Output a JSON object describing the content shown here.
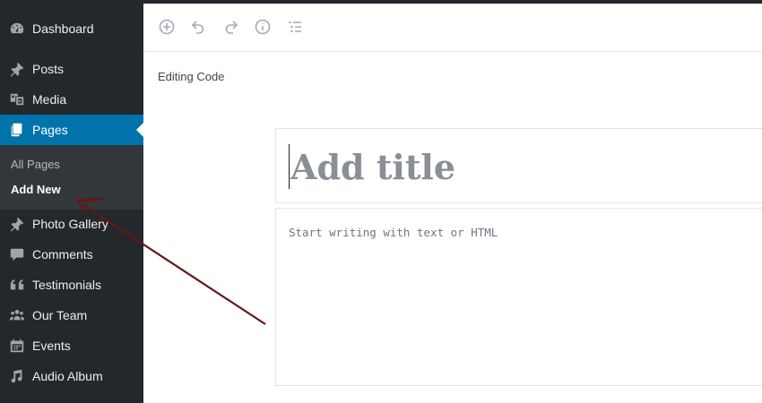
{
  "sidebar": {
    "items": [
      {
        "label": "Dashboard",
        "icon": "dashboard-icon"
      },
      {
        "label": "Posts",
        "icon": "pin-icon"
      },
      {
        "label": "Media",
        "icon": "media-icon"
      },
      {
        "label": "Pages",
        "icon": "pages-icon",
        "active": true
      },
      {
        "label": "Photo Gallery",
        "icon": "pin-icon"
      },
      {
        "label": "Comments",
        "icon": "comment-icon"
      },
      {
        "label": "Testimonials",
        "icon": "quote-icon"
      },
      {
        "label": "Our Team",
        "icon": "groups-icon"
      },
      {
        "label": "Events",
        "icon": "calendar-icon"
      },
      {
        "label": "Audio Album",
        "icon": "music-icon"
      }
    ],
    "submenu": [
      {
        "label": "All Pages"
      },
      {
        "label": "Add New",
        "current": true
      }
    ],
    "active_color": "#0073aa"
  },
  "toolbar": {
    "tools": [
      "add-block-icon",
      "undo-icon",
      "redo-icon",
      "info-icon",
      "outline-icon"
    ]
  },
  "editor": {
    "mode_label": "Editing Code",
    "title_placeholder": "Add title",
    "body_placeholder": "Start writing with text or HTML"
  },
  "annotation": {
    "arrow_color": "#6b1414"
  }
}
